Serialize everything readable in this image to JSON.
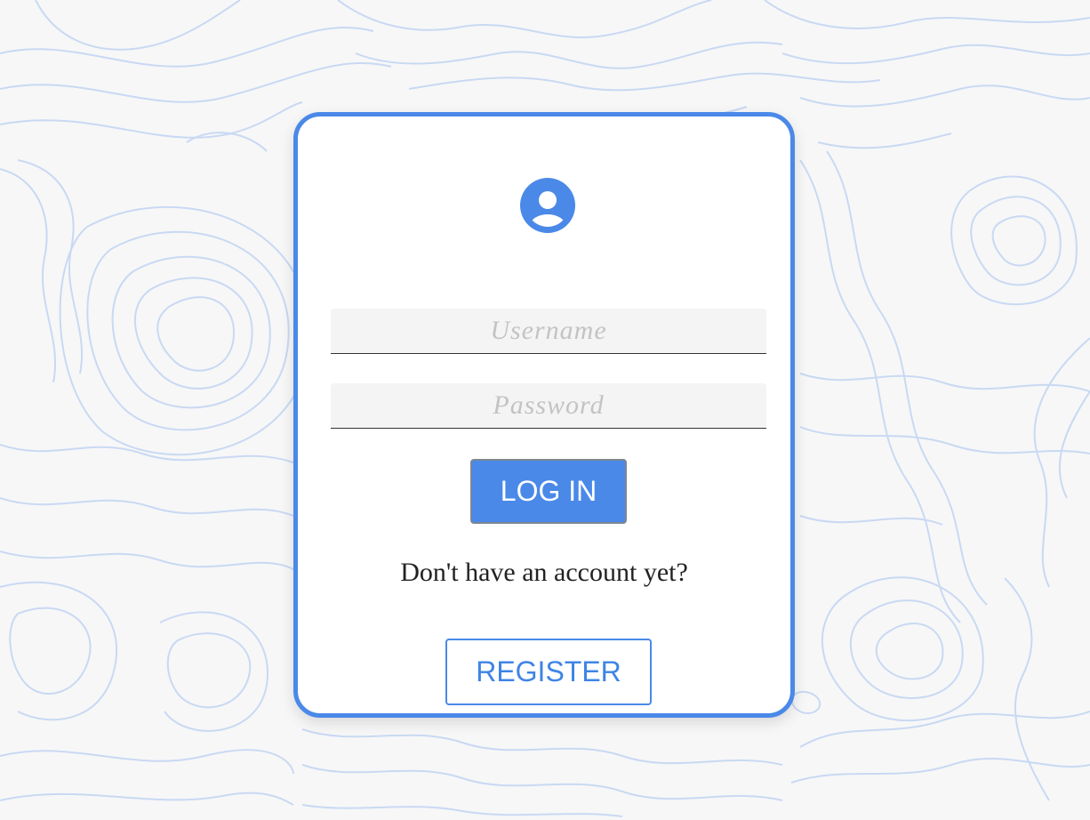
{
  "login_form": {
    "username_placeholder": "Username",
    "password_placeholder": "Password",
    "login_label": "LOG IN",
    "register_prompt": "Don't have an account yet?",
    "register_label": "REGISTER"
  },
  "icons": {
    "avatar": "user-circle-icon",
    "background": "topographic-pattern"
  },
  "colors": {
    "accent": "#4a89e8",
    "background": "#f7f7f8",
    "card": "#ffffff",
    "contour_lines": "#c9d9f2"
  }
}
